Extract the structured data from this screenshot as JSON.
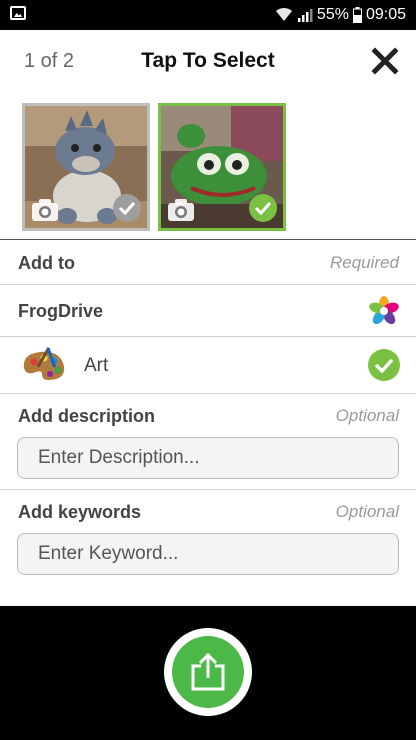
{
  "status_bar": {
    "battery_percent": "55%",
    "time": "09:05",
    "icons": [
      "gallery-icon",
      "wifi-icon",
      "signal-icon",
      "battery-icon"
    ]
  },
  "header": {
    "counter": "1 of 2",
    "title": "Tap To Select",
    "close_icon": "close-icon"
  },
  "thumbnails": [
    {
      "subject": "grey plush dinosaur",
      "selected": false,
      "type_icon": "camera-icon",
      "check_color": "#9e9e9e"
    },
    {
      "subject": "green plush frog",
      "selected": true,
      "type_icon": "camera-icon",
      "check_color": "#7ac143"
    }
  ],
  "add_to": {
    "label": "Add to",
    "hint": "Required"
  },
  "drive": {
    "name": "FrogDrive",
    "icon": "frogdrive-logo-icon"
  },
  "folder": {
    "name": "Art",
    "icon": "art-palette-icon",
    "selected": true
  },
  "description": {
    "label": "Add description",
    "hint": "Optional",
    "placeholder": "Enter Description...",
    "value": ""
  },
  "keywords": {
    "label": "Add keywords",
    "hint": "Optional",
    "placeholder": "Enter Keyword...",
    "value": ""
  },
  "footer": {
    "share_icon": "upload-share-icon"
  },
  "colors": {
    "accent_green": "#7ac143",
    "share_green": "#4cb848",
    "hint_grey": "#9a9a9a"
  }
}
